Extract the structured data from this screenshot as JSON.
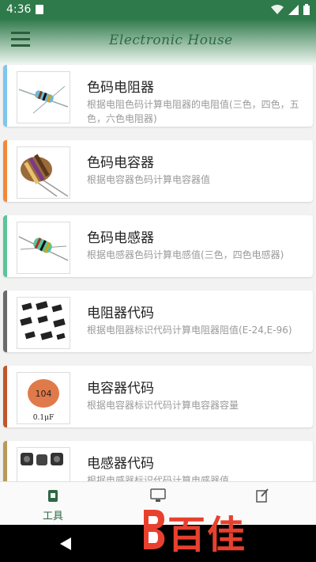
{
  "status": {
    "time": "4:36"
  },
  "app": {
    "title": "Electronic House"
  },
  "items": [
    {
      "title": "色码电阻器",
      "desc": "根据电阻色码计算电阻器的电阻值(三色，四色，五色，六色电阻器)",
      "accent": "#7dc6ee"
    },
    {
      "title": "色码电容器",
      "desc": "根据电容器色码计算电容器值",
      "accent": "#f08a3a"
    },
    {
      "title": "色码电感器",
      "desc": "根据电感器色码计算电感值(三色，四色电感器)",
      "accent": "#5cc49a"
    },
    {
      "title": "电阻器代码",
      "desc": "根据电阻器标识代码计算电阻器阻值(E-24,E-96)",
      "accent": "#6a6a6a"
    },
    {
      "title": "电容器代码",
      "desc": "根据电容器标识代码计算电容器容量",
      "accent": "#c0562a"
    },
    {
      "title": "电感器代码",
      "desc": "根据电感器标识代码计算电感器值",
      "accent": "#b89a5a"
    }
  ],
  "thumb_text": {
    "capacitor_code": "104",
    "capacitor_value": "0.1μF"
  },
  "nav": {
    "tools_label": "工具"
  },
  "watermark": {
    "text": "百佳"
  }
}
